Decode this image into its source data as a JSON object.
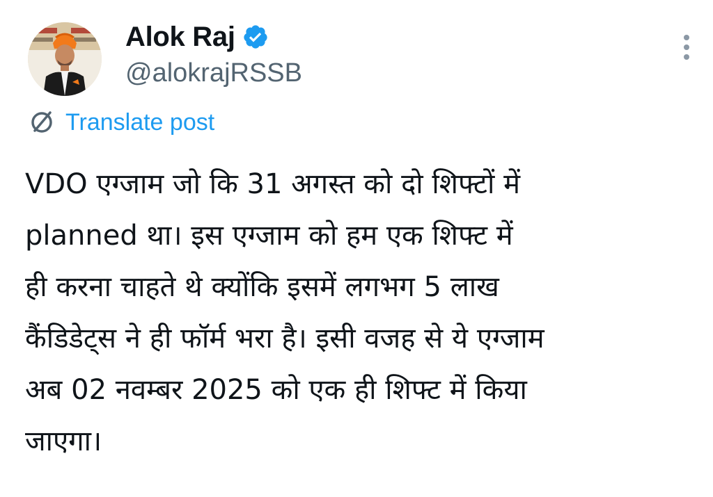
{
  "author": {
    "display_name": "Alok Raj",
    "handle": "@alokrajRSSB",
    "verified": true
  },
  "translate": {
    "label": "Translate post"
  },
  "post": {
    "lines": [
      "VDO एग्जाम जो कि 31 अगस्त को दो शिफ्टों में",
      "planned था। इस एग्जाम को हम एक शिफ्ट में",
      "ही करना चाहते थे क्योंकि इसमें लगभग 5 लाख",
      "कैंडिडेट्स ने ही फॉर्म भरा है। इसी वजह से ये एग्जाम",
      "अब 02 नवम्बर 2025 को एक ही शिफ्ट में किया",
      "जाएगा।"
    ]
  },
  "icons": {
    "verified": "verified-badge-icon",
    "more": "more-vertical-icon",
    "translate": "translate-globe-icon"
  },
  "colors": {
    "link": "#1d9bf0",
    "text": "#0f1419",
    "secondary": "#536471"
  }
}
